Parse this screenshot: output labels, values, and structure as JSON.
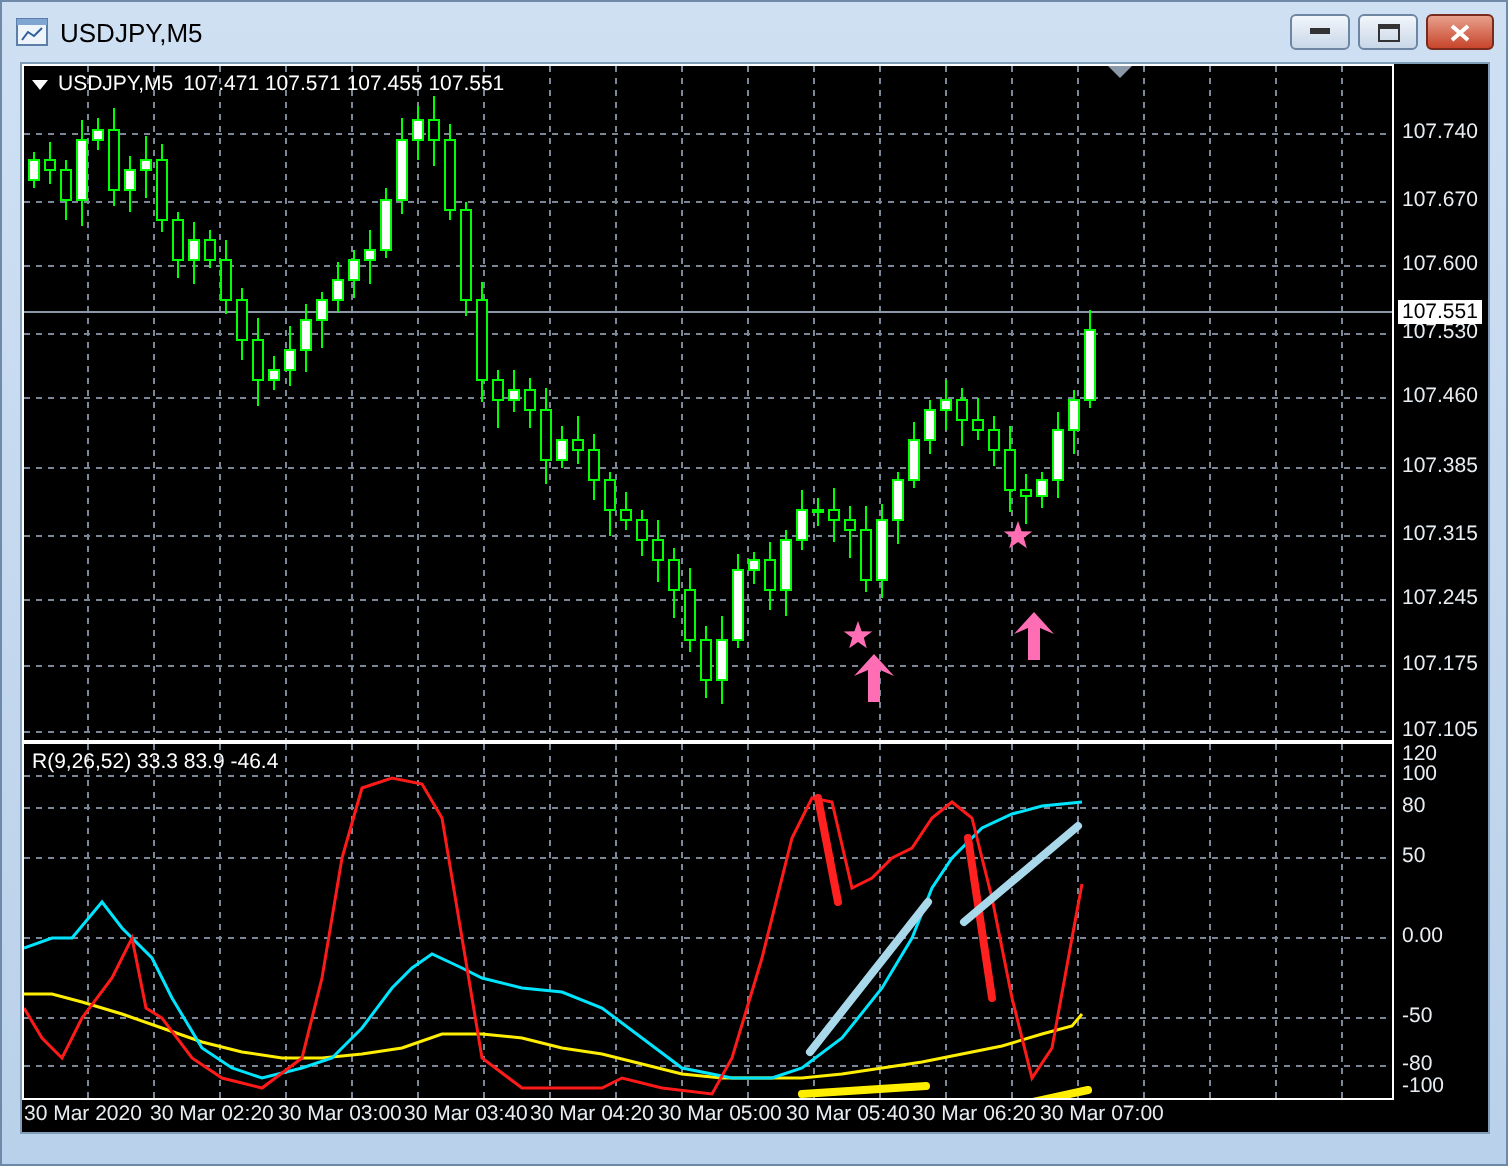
{
  "window": {
    "title": "USDJPY,M5"
  },
  "chart": {
    "symbol": "USDJPY,M5",
    "ohlc": "107.471 107.571 107.455 107.551",
    "current_price": "107.551",
    "price_labels": [
      "107.740",
      "107.670",
      "107.600",
      "107.530",
      "107.460",
      "107.385",
      "107.315",
      "107.245",
      "107.175",
      "107.105"
    ]
  },
  "indicator": {
    "legend": "R(9,26,52) 33.3 83.9 -46.4",
    "scale_labels": [
      "120",
      "100",
      "80",
      "50",
      "0.00",
      "-50",
      "-80",
      "-100"
    ]
  },
  "time_axis": {
    "labels": [
      "30 Mar 2020",
      "30 Mar 02:20",
      "30 Mar 03:00",
      "30 Mar 03:40",
      "30 Mar 04:20",
      "30 Mar 05:00",
      "30 Mar 05:40",
      "30 Mar 06:20",
      "30 Mar 07:00"
    ]
  }
}
